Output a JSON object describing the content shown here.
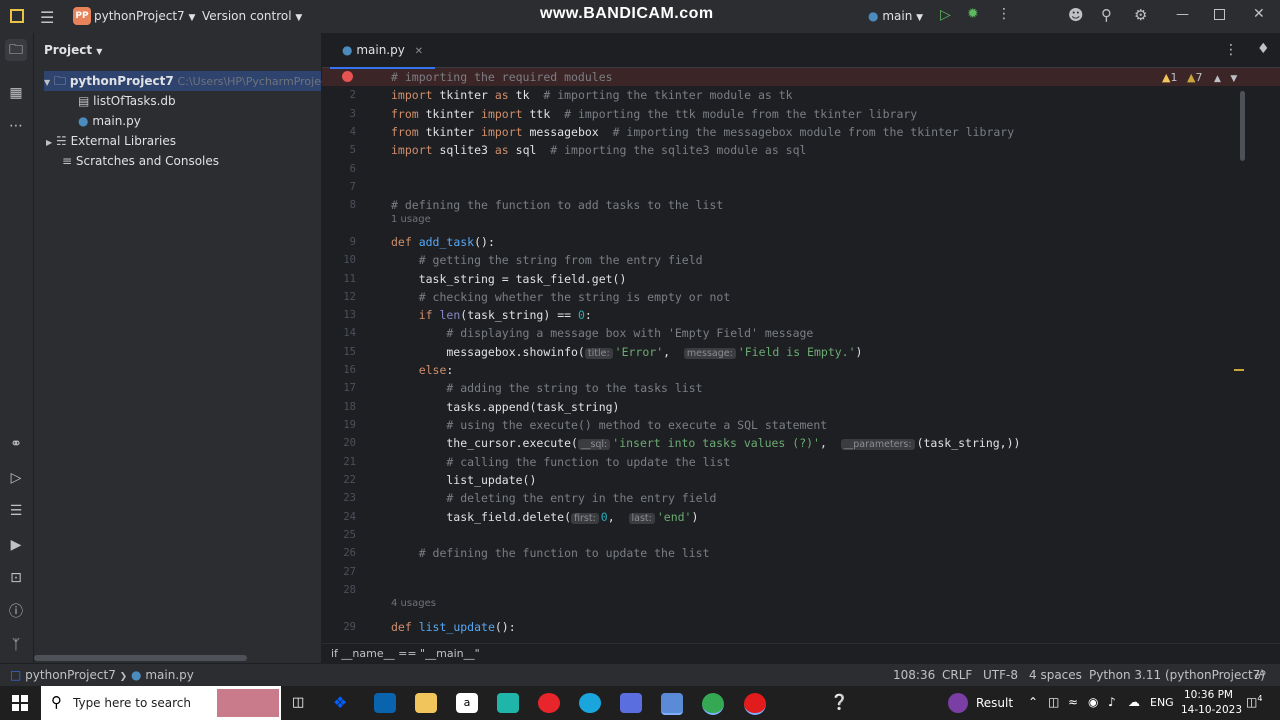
{
  "titlebar": {
    "project_badge": "PP",
    "project_name": "pythonProject7",
    "version_control": "Version control",
    "watermark": "www.BANDICAM.com",
    "branch": "main"
  },
  "project_panel": {
    "title": "Project",
    "root": {
      "name": "pythonProject7",
      "path": "C:\\Users\\HP\\PycharmProjects"
    },
    "files": [
      "listOfTasks.db",
      "main.py"
    ],
    "external": "External Libraries",
    "scratches": "Scratches and Consoles"
  },
  "editor": {
    "tab_label": "main.py",
    "warnings_count": "1",
    "weak_warnings_count": "7",
    "usage_1": "1 usage",
    "usage_2": "4 usages"
  },
  "code_lines": [
    {
      "n": "",
      "segments": [
        {
          "t": "cm",
          "v": "# importing the required modules"
        }
      ]
    },
    {
      "n": "2",
      "segments": [
        {
          "t": "kw",
          "v": "import "
        },
        {
          "t": "",
          "v": "tkinter "
        },
        {
          "t": "kw",
          "v": "as "
        },
        {
          "t": "",
          "v": "tk  "
        },
        {
          "t": "cm",
          "v": "# importing the tkinter module as tk"
        }
      ]
    },
    {
      "n": "3",
      "segments": [
        {
          "t": "kw",
          "v": "from "
        },
        {
          "t": "",
          "v": "tkinter "
        },
        {
          "t": "kw",
          "v": "import "
        },
        {
          "t": "",
          "v": "ttk  "
        },
        {
          "t": "cm",
          "v": "# importing the ttk module from the tkinter library"
        }
      ]
    },
    {
      "n": "4",
      "segments": [
        {
          "t": "kw",
          "v": "from "
        },
        {
          "t": "",
          "v": "tkinter "
        },
        {
          "t": "kw",
          "v": "import "
        },
        {
          "t": "",
          "v": "messagebox  "
        },
        {
          "t": "cm",
          "v": "# importing the messagebox module from the tkinter library"
        }
      ]
    },
    {
      "n": "5",
      "segments": [
        {
          "t": "kw",
          "v": "import "
        },
        {
          "t": "",
          "v": "sqlite3 "
        },
        {
          "t": "kw",
          "v": "as "
        },
        {
          "t": "",
          "v": "sql  "
        },
        {
          "t": "cm",
          "v": "# importing the sqlite3 module as sql"
        }
      ]
    },
    {
      "n": "6",
      "segments": []
    },
    {
      "n": "7",
      "segments": []
    },
    {
      "n": "8",
      "segments": [
        {
          "t": "cm",
          "v": "# defining the function to add tasks to the list"
        }
      ]
    },
    {
      "n": "9",
      "usage": "usage_1",
      "segments": [
        {
          "t": "kw",
          "v": "def "
        },
        {
          "t": "fn",
          "v": "add_task"
        },
        {
          "t": "",
          "v": "():"
        }
      ]
    },
    {
      "n": "10",
      "segments": [
        {
          "t": "",
          "v": "    "
        },
        {
          "t": "cm",
          "v": "# getting the string from the entry field"
        }
      ]
    },
    {
      "n": "11",
      "segments": [
        {
          "t": "",
          "v": "    task_string = task_field.get()"
        }
      ]
    },
    {
      "n": "12",
      "segments": [
        {
          "t": "",
          "v": "    "
        },
        {
          "t": "cm",
          "v": "# checking whether the string is empty or not"
        }
      ]
    },
    {
      "n": "13",
      "segments": [
        {
          "t": "",
          "v": "    "
        },
        {
          "t": "kw",
          "v": "if "
        },
        {
          "t": "bi",
          "v": "len"
        },
        {
          "t": "",
          "v": "(task_string) == "
        },
        {
          "t": "nm",
          "v": "0"
        },
        {
          "t": "",
          "v": ":"
        }
      ]
    },
    {
      "n": "14",
      "segments": [
        {
          "t": "",
          "v": "        "
        },
        {
          "t": "cm",
          "v": "# displaying a message box with 'Empty Field' message"
        }
      ]
    },
    {
      "n": "15",
      "segments": [
        {
          "t": "",
          "v": "        messagebox.showinfo("
        },
        {
          "t": "hint",
          "v": "title:"
        },
        {
          "t": "st",
          "v": "'Error'"
        },
        {
          "t": "",
          "v": ",  "
        },
        {
          "t": "hint",
          "v": "message:"
        },
        {
          "t": "st",
          "v": "'Field is Empty.'"
        },
        {
          "t": "",
          "v": ")"
        }
      ]
    },
    {
      "n": "16",
      "segments": [
        {
          "t": "",
          "v": "    "
        },
        {
          "t": "kw",
          "v": "else"
        },
        {
          "t": "",
          "v": ":"
        }
      ]
    },
    {
      "n": "17",
      "segments": [
        {
          "t": "",
          "v": "        "
        },
        {
          "t": "cm",
          "v": "# adding the string to the tasks list"
        }
      ]
    },
    {
      "n": "18",
      "segments": [
        {
          "t": "",
          "v": "        tasks.append(task_string)"
        }
      ]
    },
    {
      "n": "19",
      "segments": [
        {
          "t": "",
          "v": "        "
        },
        {
          "t": "cm",
          "v": "# using the execute() method to execute a SQL statement"
        }
      ]
    },
    {
      "n": "20",
      "segments": [
        {
          "t": "",
          "v": "        the_cursor.execute("
        },
        {
          "t": "hint",
          "v": "__sql:"
        },
        {
          "t": "st",
          "v": "'insert into tasks values (?)'"
        },
        {
          "t": "",
          "v": ",  "
        },
        {
          "t": "hint",
          "v": "__parameters:"
        },
        {
          "t": "",
          "v": "(task_string,))"
        }
      ]
    },
    {
      "n": "21",
      "segments": [
        {
          "t": "",
          "v": "        "
        },
        {
          "t": "cm",
          "v": "# calling the function to update the list"
        }
      ]
    },
    {
      "n": "22",
      "segments": [
        {
          "t": "",
          "v": "        list_update()"
        }
      ]
    },
    {
      "n": "23",
      "segments": [
        {
          "t": "",
          "v": "        "
        },
        {
          "t": "cm",
          "v": "# deleting the entry in the entry field"
        }
      ]
    },
    {
      "n": "24",
      "segments": [
        {
          "t": "",
          "v": "        task_field.delete("
        },
        {
          "t": "hint",
          "v": "first:"
        },
        {
          "t": "nm",
          "v": "0"
        },
        {
          "t": "",
          "v": ",  "
        },
        {
          "t": "hint",
          "v": "last:"
        },
        {
          "t": "st",
          "v": "'end'"
        },
        {
          "t": "",
          "v": ")"
        }
      ]
    },
    {
      "n": "25",
      "segments": []
    },
    {
      "n": "26",
      "segments": [
        {
          "t": "",
          "v": "    "
        },
        {
          "t": "cm",
          "v": "# defining the function to update the list"
        }
      ]
    },
    {
      "n": "27",
      "segments": []
    },
    {
      "n": "28",
      "segments": []
    },
    {
      "n": "29",
      "usage": "usage_2",
      "segments": [
        {
          "t": "kw",
          "v": "def "
        },
        {
          "t": "fn",
          "v": "list_update"
        },
        {
          "t": "",
          "v": "():"
        }
      ]
    }
  ],
  "code_breadcrumb": "if __name__ == \"__main__\"",
  "statusbar": {
    "project": "pythonProject7",
    "file": "main.py",
    "position": "108:36",
    "line_sep": "CRLF",
    "encoding": "UTF-8",
    "indent": "4 spaces",
    "interpreter": "Python 3.11 (pythonProject7)"
  },
  "taskbar": {
    "search_placeholder": "Type here to search",
    "result": "Result",
    "lang": "ENG",
    "time": "10:36 PM",
    "date": "14-10-2023",
    "notif_count": "4"
  },
  "colors": {
    "accent": "#3574f0",
    "breakpoint": "#e55353",
    "run": "#5fb85f",
    "warning": "#f2c55c"
  }
}
